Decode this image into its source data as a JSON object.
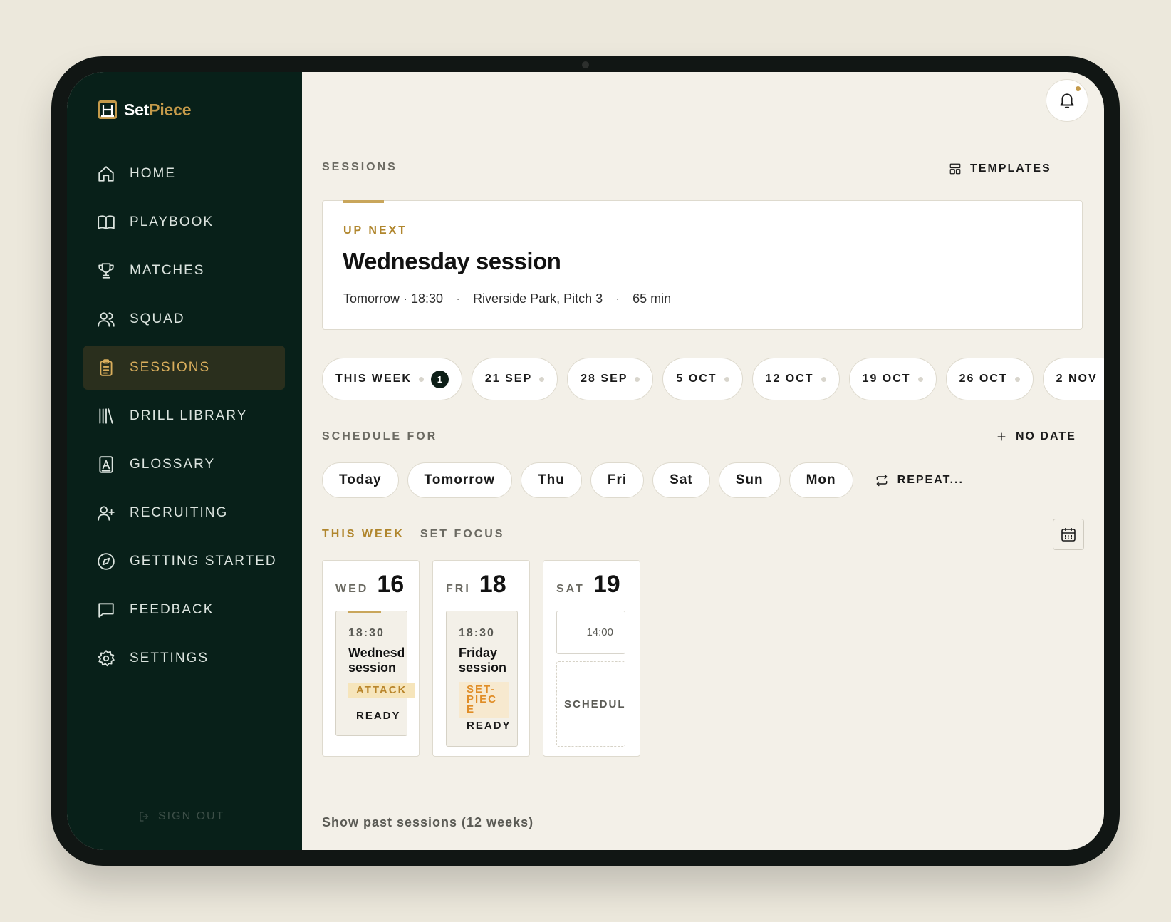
{
  "app": {
    "brand_part1": "Set",
    "brand_part2": "Piece",
    "accent_color": "#c49a4a"
  },
  "sidebar": {
    "items": [
      {
        "label": "HOME",
        "icon": "home-icon"
      },
      {
        "label": "PLAYBOOK",
        "icon": "book-icon"
      },
      {
        "label": "MATCHES",
        "icon": "trophy-icon"
      },
      {
        "label": "SQUAD",
        "icon": "users-icon"
      },
      {
        "label": "SESSIONS",
        "icon": "clipboard-icon",
        "active": true
      },
      {
        "label": "DRILL LIBRARY",
        "icon": "library-icon"
      },
      {
        "label": "GLOSSARY",
        "icon": "glossary-icon"
      },
      {
        "label": "RECRUITING",
        "icon": "user-plus-icon"
      },
      {
        "label": "GETTING STARTED",
        "icon": "compass-icon"
      },
      {
        "label": "FEEDBACK",
        "icon": "message-icon"
      },
      {
        "label": "SETTINGS",
        "icon": "gear-icon"
      }
    ],
    "sign_out": "SIGN OUT"
  },
  "main": {
    "section_title": "SESSIONS",
    "templates_label": "TEMPLATES",
    "up_next": {
      "label": "UP NEXT",
      "title": "Wednesday session",
      "when": "Tomorrow · 18:30",
      "location": "Riverside Park, Pitch 3",
      "duration": "65 min"
    },
    "week_chips": [
      {
        "label": "THIS WEEK",
        "count": "1"
      },
      {
        "label": "21 SEP"
      },
      {
        "label": "28 SEP"
      },
      {
        "label": "5 OCT"
      },
      {
        "label": "12 OCT"
      },
      {
        "label": "19 OCT"
      },
      {
        "label": "26 OCT"
      },
      {
        "label": "2 NOV"
      }
    ],
    "schedule_for_label": "SCHEDULE FOR",
    "no_date_label": "NO DATE",
    "day_chips": [
      "Today",
      "Tomorrow",
      "Thu",
      "Fri",
      "Sat",
      "Sun",
      "Mon"
    ],
    "repeat_label": "REPEAT...",
    "tabs": {
      "this_week": "THIS WEEK",
      "set_focus": "SET FOCUS"
    },
    "days": [
      {
        "abbr": "WED",
        "num": "16",
        "time": "18:30",
        "title": "Wednesday session",
        "tag": "ATTACK",
        "status": "READY"
      },
      {
        "abbr": "FRI",
        "num": "18",
        "time": "18:30",
        "title": "Friday session",
        "tag": "SET-PIECE",
        "status": "READY"
      },
      {
        "abbr": "SAT",
        "num": "19",
        "slot_time": "14:00",
        "schedule_label": "SCHEDULE"
      }
    ],
    "past_link": "Show past sessions (12 weeks)"
  }
}
